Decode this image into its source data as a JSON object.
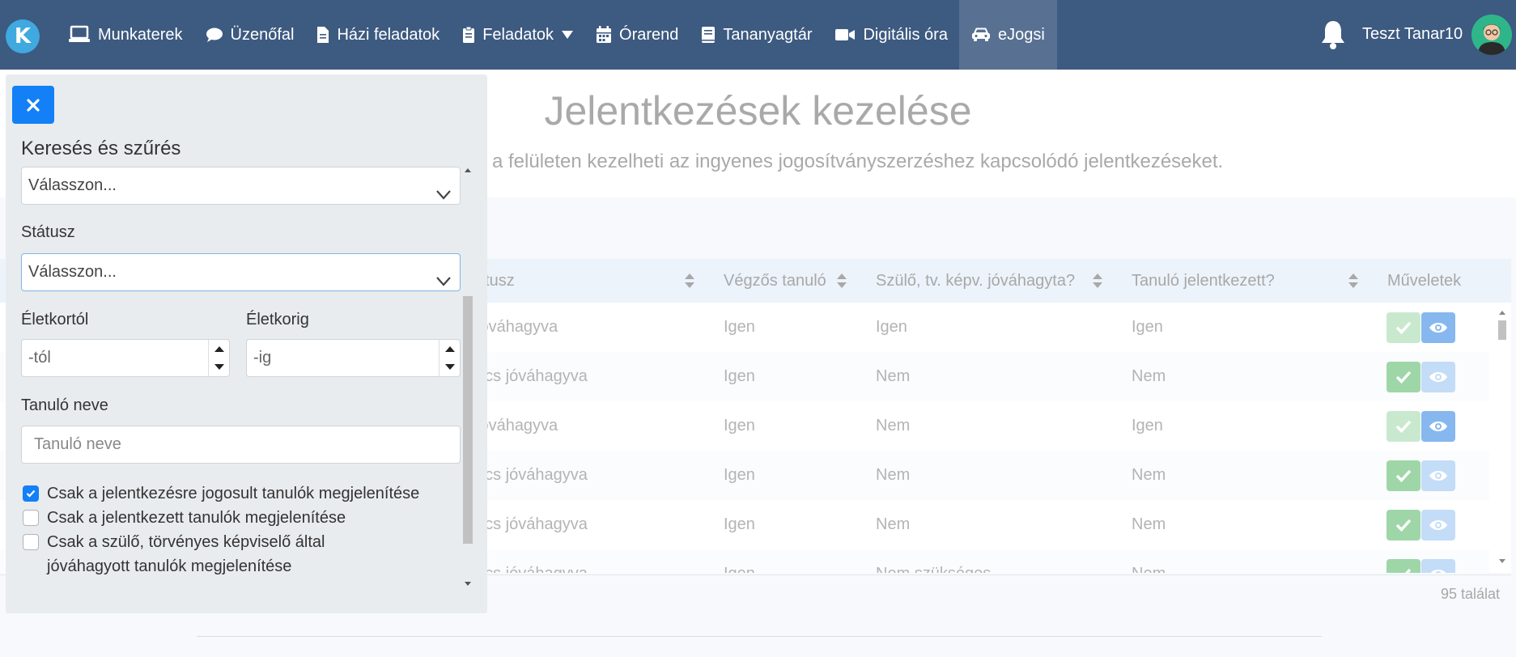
{
  "navbar": {
    "logo_letter": "K",
    "items": [
      {
        "label": "Munkaterek",
        "icon": "laptop-icon"
      },
      {
        "label": "Üzenőfal",
        "icon": "comment-icon"
      },
      {
        "label": "Házi feladatok",
        "icon": "file-icon"
      },
      {
        "label": "Feladatok",
        "icon": "clipboard-icon"
      },
      {
        "label": "Órarend",
        "icon": "calendar-icon"
      },
      {
        "label": "Tananyagtár",
        "icon": "book-icon"
      },
      {
        "label": "Digitális óra",
        "icon": "video-icon"
      },
      {
        "label": "eJogsi",
        "icon": "car-icon"
      }
    ],
    "active_item": "eJogsi",
    "username": "Teszt Tanar10"
  },
  "page": {
    "title": "Jelentkezések kezelése",
    "subtitle": "a felületen kezelheti az ingyenes jogosítványszerzéshez kapcsolódó jelentkezéseket."
  },
  "table": {
    "headers": [
      "átusz",
      "Végzős tanuló",
      "Szülő, tv. képv. jóváhagyta?",
      "Tanuló jelentkezett?",
      "Műveletek"
    ],
    "rows": [
      [
        "jóváhagyva",
        "Igen",
        "Igen",
        "Igen"
      ],
      [
        "ncs jóváhagyva",
        "Igen",
        "Nem",
        "Nem"
      ],
      [
        "jóváhagyva",
        "Igen",
        "Nem",
        "Igen"
      ],
      [
        "ncs jóváhagyva",
        "Igen",
        "Nem",
        "Nem"
      ],
      [
        "ncs jóváhagyva",
        "Igen",
        "Nem",
        "Nem"
      ],
      [
        "ncs jóváhagyva",
        "Igen",
        "Nem szükséges",
        "Nem"
      ]
    ],
    "result_count": "95 találat"
  },
  "filter": {
    "title": "Keresés és szűrés",
    "select1_value": "Válasszon...",
    "status_label": "Státusz",
    "status_value": "Válasszon...",
    "age_from_label": "Életkortól",
    "age_from_placeholder": "-tól",
    "age_to_label": "Életkorig",
    "age_to_placeholder": "-ig",
    "student_label": "Tanuló neve",
    "student_placeholder": "Tanuló neve",
    "checkboxes": [
      {
        "label": "Csak a jelentkezésre jogosult tanulók megjelenítése",
        "checked": true
      },
      {
        "label": "Csak a jelentkezett tanulók megjelenítése",
        "checked": false
      },
      {
        "label": "Csak a szülő, törvényes képviselő által jóváhagyott tanulók megjelenítése",
        "checked": false
      }
    ]
  },
  "colors": {
    "navbar": "#3d5a80",
    "primary": "#1380f7",
    "success": "#9ed6a8",
    "info": "#86b8ef"
  }
}
